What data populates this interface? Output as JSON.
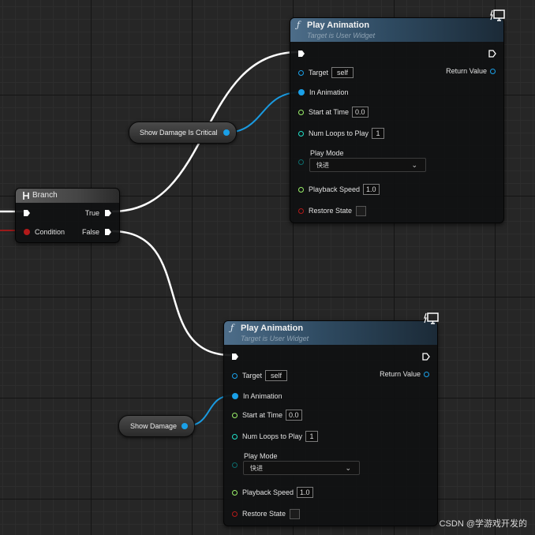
{
  "colors": {
    "exec_pin": "#ffffff",
    "object_pin": "#1aa0e8",
    "float_pin": "#9af06a",
    "int_pin": "#20e0c8",
    "enum_pin": "#0d6a6a",
    "bool_pin": "#b31a1a",
    "function_header": "#4d6d89"
  },
  "branch": {
    "title": "Branch",
    "icon": "branch-icon",
    "true_label": "True",
    "false_label": "False",
    "condition_label": "Condition"
  },
  "play_animation_nodes": [
    {
      "title": "Play Animation",
      "subtitle": "Target is User Widget",
      "function_icon": "ƒ",
      "target_label": "Target",
      "target_value": "self",
      "return_label": "Return Value",
      "in_animation_label": "In Animation",
      "start_time_label": "Start at Time",
      "start_time_value": "0.0",
      "num_loops_label": "Num Loops to Play",
      "num_loops_value": "1",
      "play_mode_label": "Play Mode",
      "play_mode_value": "快进",
      "playback_speed_label": "Playback Speed",
      "playback_speed_value": "1.0",
      "restore_state_label": "Restore State",
      "restore_state_checked": false
    },
    {
      "title": "Play Animation",
      "subtitle": "Target is User Widget",
      "function_icon": "ƒ",
      "target_label": "Target",
      "target_value": "self",
      "return_label": "Return Value",
      "in_animation_label": "In Animation",
      "start_time_label": "Start at Time",
      "start_time_value": "0.0",
      "num_loops_label": "Num Loops to Play",
      "num_loops_value": "1",
      "play_mode_label": "Play Mode",
      "play_mode_value": "快进",
      "playback_speed_label": "Playback Speed",
      "playback_speed_value": "1.0",
      "restore_state_label": "Restore State",
      "restore_state_checked": false
    }
  ],
  "variables": {
    "show_damage_is_critical": "Show Damage Is Critical",
    "show_damage": "Show Damage"
  },
  "watermark": "CSDN @学游戏开发的"
}
